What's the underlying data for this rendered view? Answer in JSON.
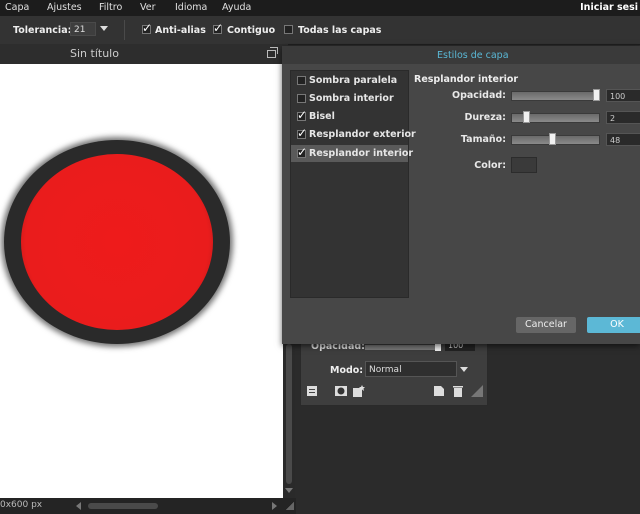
{
  "menu": {
    "items": [
      "Capa",
      "Ajustes",
      "Filtro",
      "Ver",
      "Idioma",
      "Ayuda"
    ],
    "sign_in": "Iniciar sesi"
  },
  "toolbar": {
    "tolerance_label": "Tolerancia:",
    "tolerance_value": "21",
    "antialias_label": "Anti-alias",
    "antialias_checked": true,
    "contiguous_label": "Contiguo",
    "contiguous_checked": true,
    "all_layers_label": "Todas las capas",
    "all_layers_checked": false
  },
  "canvas": {
    "title": "Sin título",
    "status": "0x600 px",
    "shape_colors": {
      "fill": "#ee1b1b",
      "rim": "#2a2a2a"
    }
  },
  "layers_panel": {
    "opacity_label": "Opacidad:",
    "opacity_value": "100",
    "mode_label": "Modo:",
    "mode_value": "Normal"
  },
  "dialog": {
    "title": "Estilos de capa",
    "styles": [
      {
        "label": "Sombra paralela",
        "checked": false,
        "selected": false
      },
      {
        "label": "Sombra interior",
        "checked": false,
        "selected": false
      },
      {
        "label": "Bisel",
        "checked": true,
        "selected": false
      },
      {
        "label": "Resplandor exterior",
        "checked": true,
        "selected": false
      },
      {
        "label": "Resplandor interior",
        "checked": true,
        "selected": true
      }
    ],
    "props_title": "Resplandor interior",
    "opacity_label": "Opacidad:",
    "opacity_value": "100",
    "hardness_label": "Dureza:",
    "hardness_value": "2",
    "size_label": "Tamaño:",
    "size_value": "48",
    "color_label": "Color:",
    "glow_color": "#3a3a3a",
    "cancel_label": "Cancelar",
    "ok_label": "OK"
  }
}
